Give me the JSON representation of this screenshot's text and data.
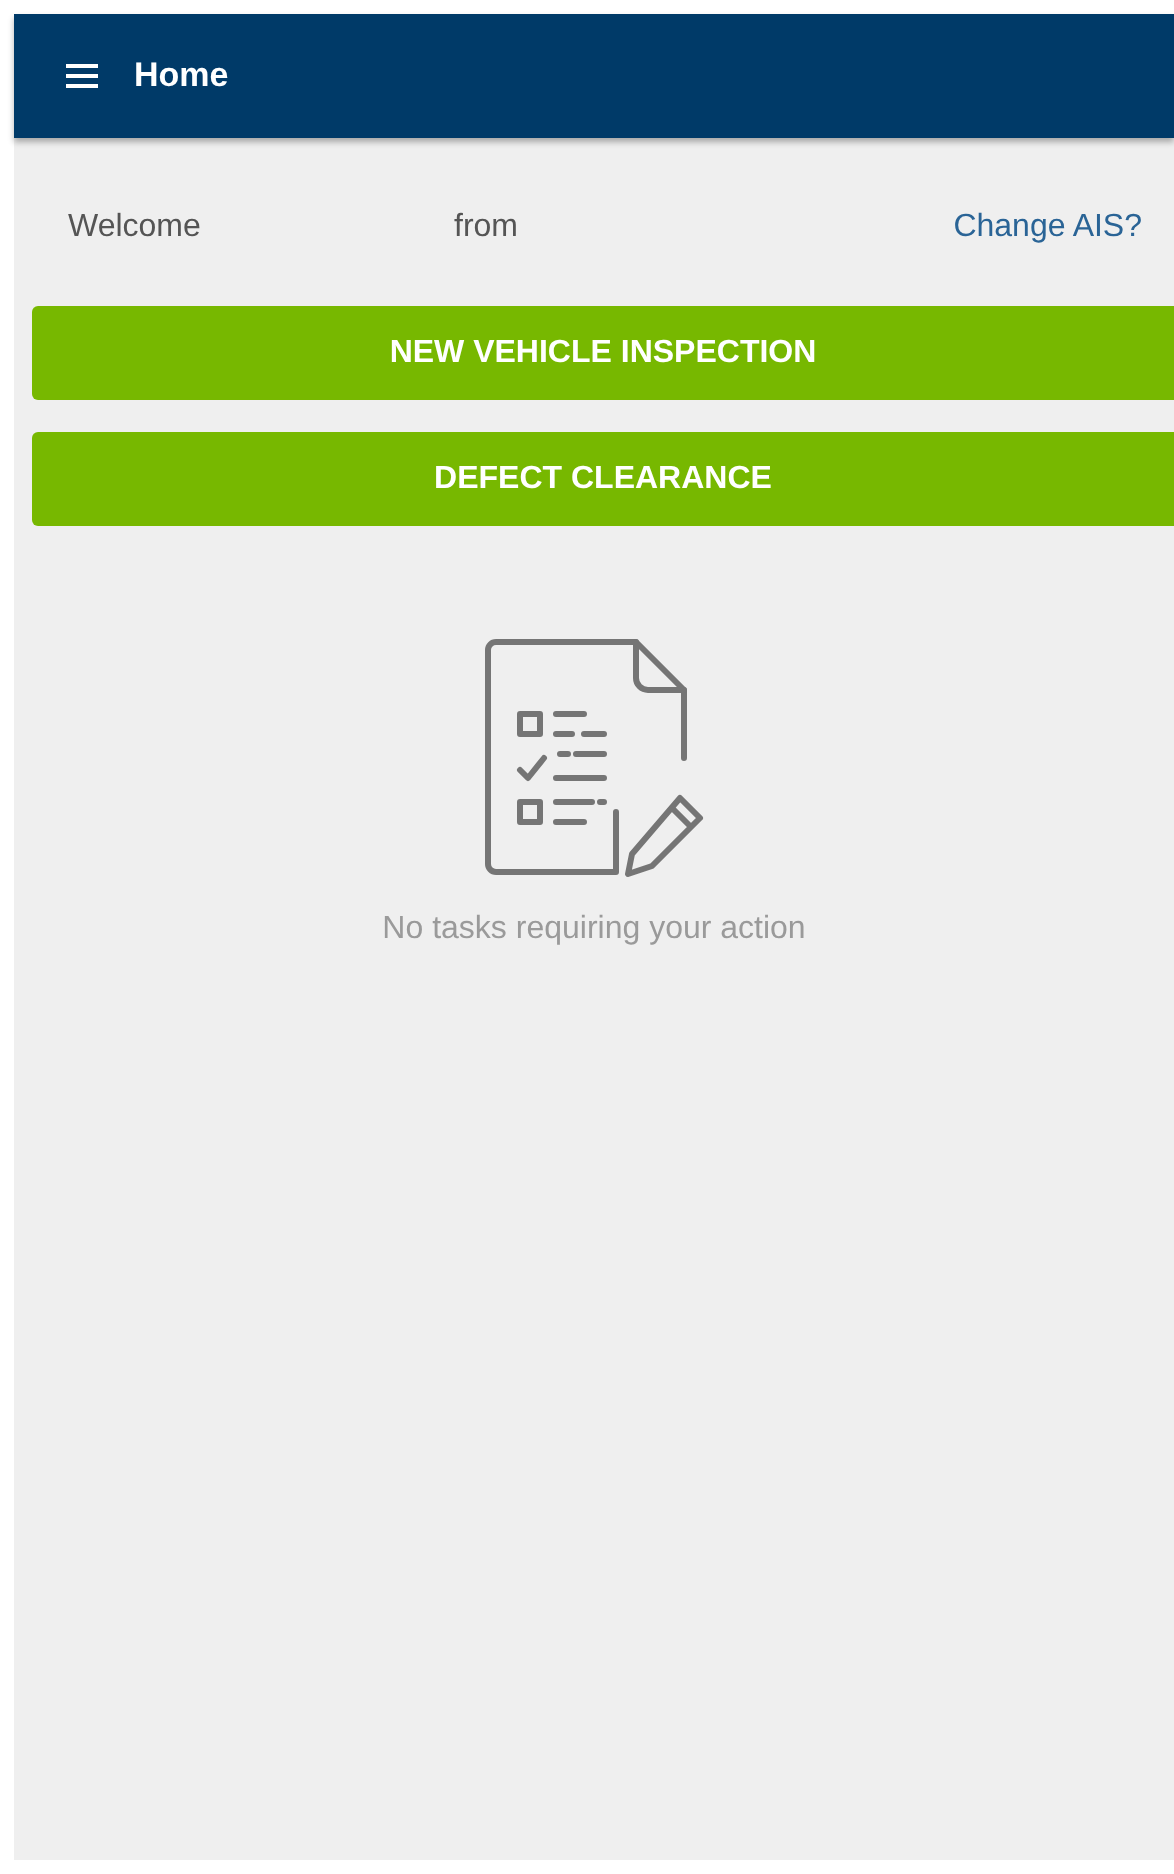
{
  "header": {
    "title": "Home"
  },
  "welcome": {
    "greeting": "Welcome",
    "from": "from",
    "link": "Change AIS?"
  },
  "buttons": [
    "NEW VEHICLE INSPECTION",
    "DEFECT CLEARANCE"
  ],
  "empty_state": {
    "message": "No tasks requiring your action"
  }
}
